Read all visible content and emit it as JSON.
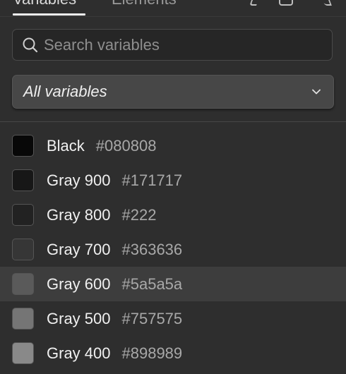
{
  "tabs": [
    {
      "label": "Variables"
    },
    {
      "label": "Elements"
    }
  ],
  "search": {
    "placeholder": "Search variables",
    "value": ""
  },
  "filter": {
    "selected": "All variables"
  },
  "variables": [
    {
      "name": "Black",
      "value": "#080808",
      "color": "#080808"
    },
    {
      "name": "Gray 900",
      "value": "#171717",
      "color": "#171717"
    },
    {
      "name": "Gray 800",
      "value": "#222",
      "color": "#222222"
    },
    {
      "name": "Gray 700",
      "value": "#363636",
      "color": "#363636"
    },
    {
      "name": "Gray 600",
      "value": "#5a5a5a",
      "color": "#5a5a5a"
    },
    {
      "name": "Gray 500",
      "value": "#757575",
      "color": "#757575"
    },
    {
      "name": "Gray 400",
      "value": "#898989",
      "color": "#898989"
    }
  ],
  "selected_index": 4,
  "colors": {
    "panel_bg": "#2e2e2e",
    "selected_row_bg": "#3d3d3d",
    "search_bg": "#262626",
    "dropdown_bg": "#474747"
  }
}
